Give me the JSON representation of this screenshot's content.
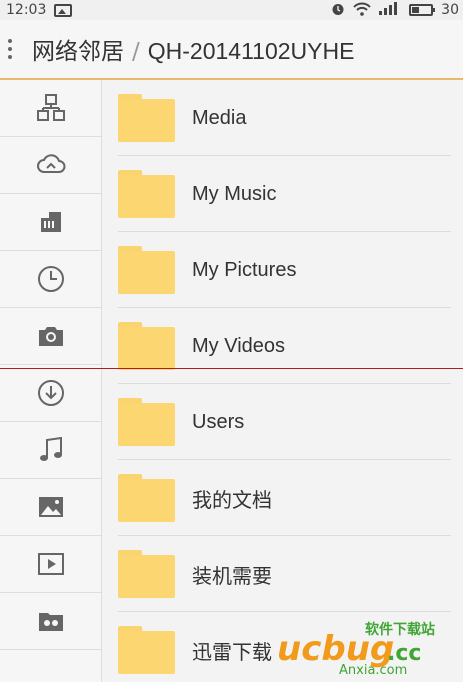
{
  "status_bar": {
    "time": "12:03",
    "battery": "30"
  },
  "title_bar": {
    "parent": "网络邻居",
    "separator": "/",
    "current": "QH-20141102UYHE"
  },
  "sidebar": {
    "items": [
      {
        "icon": "network-icon"
      },
      {
        "icon": "cloud-icon"
      },
      {
        "icon": "storage-icon"
      },
      {
        "icon": "clock-icon"
      },
      {
        "icon": "camera-icon"
      },
      {
        "icon": "download-icon"
      },
      {
        "icon": "music-icon"
      },
      {
        "icon": "image-icon"
      },
      {
        "icon": "video-icon"
      },
      {
        "icon": "folder-box-icon"
      }
    ]
  },
  "files": [
    {
      "name": "Media"
    },
    {
      "name": "My Music"
    },
    {
      "name": "My Pictures"
    },
    {
      "name": "My Videos"
    },
    {
      "name": "Users"
    },
    {
      "name": "我的文档"
    },
    {
      "name": "装机需要"
    },
    {
      "name": "迅雷下载"
    }
  ],
  "watermark": {
    "line1": "软件下载站",
    "line2": "Anxia.com"
  },
  "colors": {
    "folder": "#fbd671",
    "accent_line": "#e8b86a",
    "guide_line": "#b01d1d"
  }
}
